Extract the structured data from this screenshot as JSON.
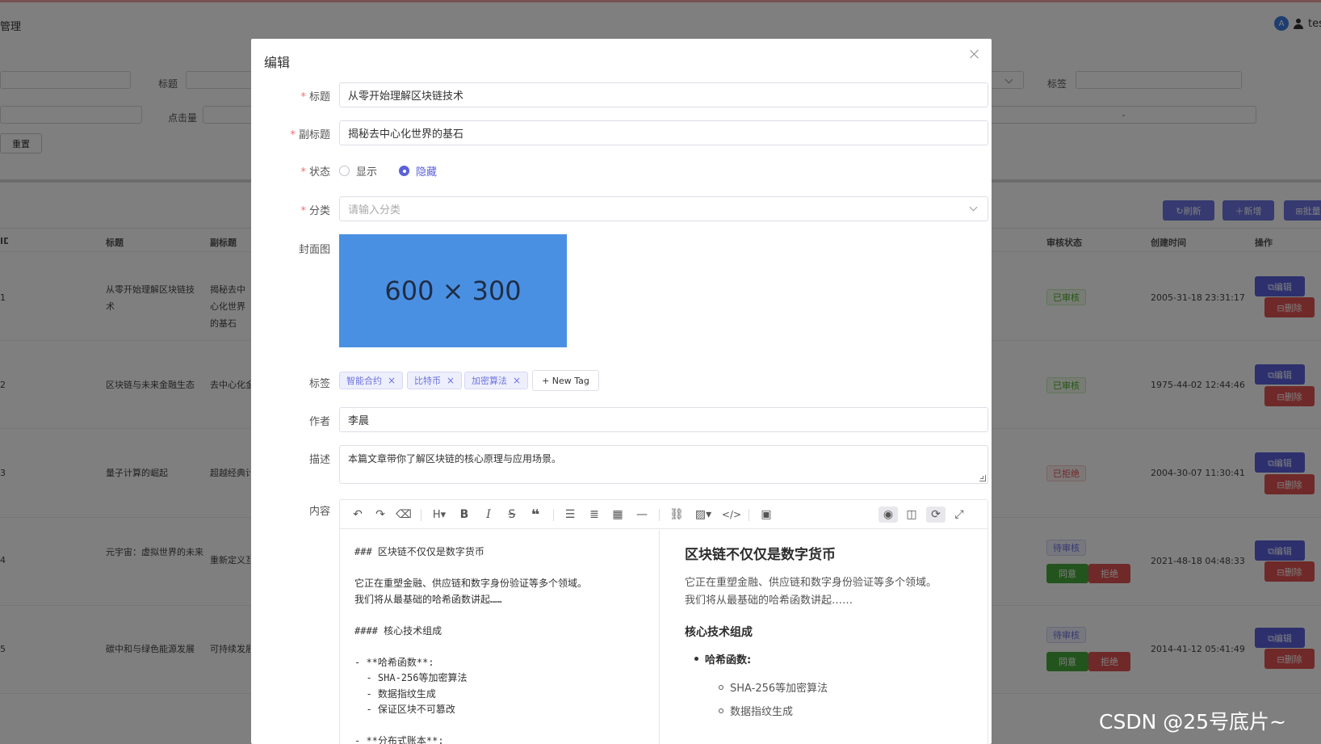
{
  "app": {
    "title": "管理",
    "user_avatar": "A",
    "user_name": "tes"
  },
  "filters": {
    "title_label": "标题",
    "tags_label": "标签",
    "clicks_label": "点击量",
    "date_sep": "-",
    "reset_button": "重置"
  },
  "toolbar": {
    "refresh": "↻刷新",
    "add": "＋新增",
    "batch": "⊞批量"
  },
  "table": {
    "headers": [
      "ID",
      "标题",
      "副标题",
      "审核状态",
      "创建时间",
      "操作"
    ],
    "edit_label": "⧉编辑",
    "delete_label": "⊟删除",
    "agree_label": "同意",
    "reject_label": "拒绝",
    "rows": [
      {
        "id": "1",
        "title": "从零开始理解区块链技术",
        "subtitle": "揭秘去中心化世界的基石",
        "status": "已审核",
        "created": "2005-31-18 23:31:17"
      },
      {
        "id": "2",
        "title": "区块链与未来金融生态",
        "subtitle": "去中心化金融",
        "status": "已审核",
        "created": "1975-44-02 12:44:46"
      },
      {
        "id": "3",
        "title": "量子计算的崛起",
        "subtitle": "超越经典计算",
        "status": "已拒绝",
        "created": "2004-30-07 11:30:41"
      },
      {
        "id": "4",
        "title": "元宇宙：虚拟世界的未来",
        "subtitle": "重新定义互联网",
        "status": "待审核",
        "created": "2021-48-18 04:48:33"
      },
      {
        "id": "5",
        "title": "碳中和与绿色能源发展",
        "subtitle": "可持续发展之路",
        "status": "待审核",
        "created": "2014-41-12 05:41:49"
      }
    ]
  },
  "dialog": {
    "title": "编辑",
    "fields": {
      "title_label": "标题",
      "title_value": "从零开始理解区块链技术",
      "subtitle_label": "副标题",
      "subtitle_value": "揭秘去中心化世界的基石",
      "status_label": "状态",
      "status_options": [
        "显示",
        "隐藏"
      ],
      "status_selected": "隐藏",
      "category_label": "分类",
      "category_placeholder": "请输入分类",
      "cover_label": "封面图",
      "cover_text": "600 × 300",
      "cover_color": "#4a90e2",
      "tags_label": "标签",
      "tags": [
        "智能合约",
        "比特币",
        "加密算法"
      ],
      "new_tag_button": "+ New Tag",
      "author_label": "作者",
      "author_value": "李晨",
      "desc_label": "描述",
      "desc_value": "本篇文章带你了解区块链的核心原理与应用场景。",
      "content_label": "内容"
    },
    "editor": {
      "toolbar_icons": [
        "undo-icon",
        "redo-icon",
        "eraser-icon",
        "heading-icon",
        "bold-icon",
        "italic-icon",
        "strikethrough-icon",
        "quote-icon",
        "bullet-list-icon",
        "ordered-list-icon",
        "table-icon",
        "hr-icon",
        "link-icon",
        "image-icon",
        "code-icon",
        "save-icon",
        "preview-icon",
        "layout-icon",
        "sync-scroll-icon",
        "fullscreen-icon"
      ],
      "source": "### 区块链不仅仅是数字货币\n\n它正在重塑金融、供应链和数字身份验证等多个领域。\n我们将从最基础的哈希函数讲起……\n\n#### 核心技术组成\n\n- **哈希函数**:\n  - SHA-256等加密算法\n  - 数据指纹生成\n  - 保证区块不可篡改\n\n- **分布式账本**:",
      "preview_h3": "区块链不仅仅是数字货币",
      "preview_p1": "它正在重塑金融、供应链和数字身份验证等多个领域。",
      "preview_p2": "我们将从最基础的哈希函数讲起……",
      "preview_h4": "核心技术组成",
      "preview_li": "哈希函数:",
      "preview_sub": [
        "SHA-256等加密算法",
        "数据指纹生成"
      ]
    }
  },
  "watermark": "CSDN @25号底片~",
  "colors": {
    "primary": "#5b61db",
    "danger": "#f56c6c",
    "success": "#47a83a"
  }
}
